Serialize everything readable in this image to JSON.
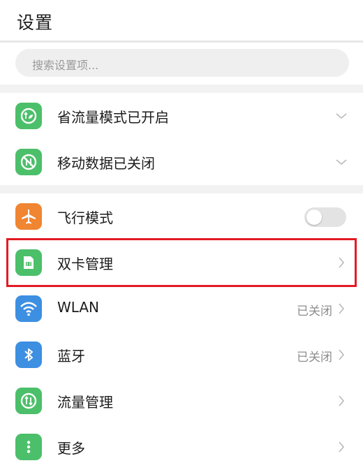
{
  "header": {
    "title": "设置"
  },
  "search": {
    "placeholder": "搜索设置项..."
  },
  "items": {
    "data_saver": {
      "label": "省流量模式已开启",
      "icon": "leaf-data-icon"
    },
    "mobile_data": {
      "label": "移动数据已关闭",
      "icon": "mobile-data-off-icon"
    },
    "airplane": {
      "label": "飞行模式",
      "icon": "airplane-icon",
      "toggle_on": false
    },
    "dual_sim": {
      "label": "双卡管理",
      "icon": "sim-card-icon",
      "highlighted": true
    },
    "wlan": {
      "label": "WLAN",
      "status": "已关闭",
      "icon": "wifi-icon"
    },
    "bluetooth": {
      "label": "蓝牙",
      "status": "已关闭",
      "icon": "bluetooth-icon"
    },
    "traffic": {
      "label": "流量管理",
      "icon": "traffic-icon"
    },
    "more": {
      "label": "更多",
      "icon": "more-dots-icon"
    }
  },
  "colors": {
    "green_icon": "#4cbf6a",
    "orange_icon": "#f08532",
    "blue_icon": "#3d8fe2",
    "highlight_border": "#e21b24"
  }
}
